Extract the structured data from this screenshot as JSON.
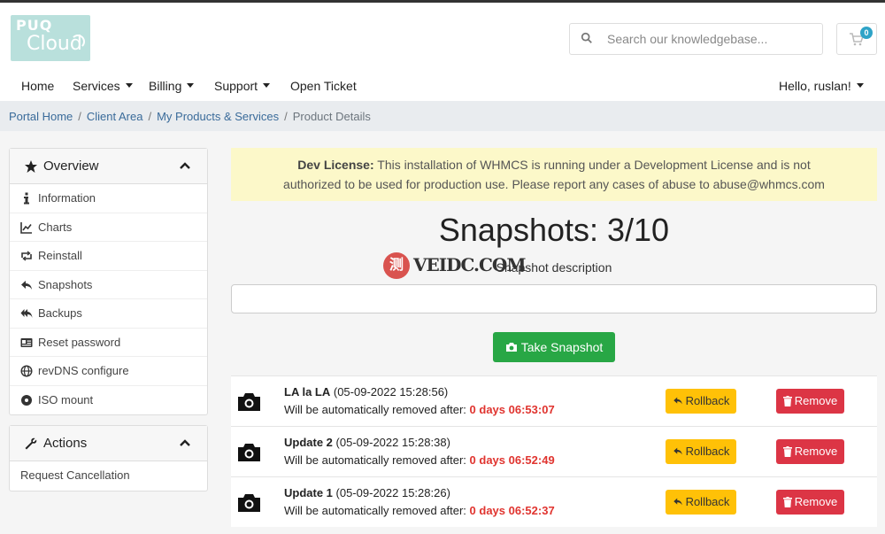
{
  "brand": {
    "logo_line1": "PUQ",
    "logo_line2": "Cloud"
  },
  "search": {
    "placeholder": "Search our knowledgebase..."
  },
  "cart": {
    "count": "0"
  },
  "nav": {
    "home": "Home",
    "services": "Services",
    "billing": "Billing",
    "support": "Support",
    "open_ticket": "Open Ticket",
    "user": "Hello, ruslan!"
  },
  "breadcrumb": {
    "portal_home": "Portal Home",
    "client_area": "Client Area",
    "products": "My Products & Services",
    "current": "Product Details"
  },
  "overview": {
    "title": "Overview",
    "items": [
      {
        "label": "Information",
        "icon": "info-icon"
      },
      {
        "label": "Charts",
        "icon": "chart-icon"
      },
      {
        "label": "Reinstall",
        "icon": "retweet-icon"
      },
      {
        "label": "Snapshots",
        "icon": "reply-icon"
      },
      {
        "label": "Backups",
        "icon": "reply-all-icon"
      },
      {
        "label": "Reset password",
        "icon": "id-card-icon"
      },
      {
        "label": "revDNS configure",
        "icon": "globe-icon"
      },
      {
        "label": "ISO mount",
        "icon": "disc-icon"
      }
    ]
  },
  "actions": {
    "title": "Actions",
    "items": [
      {
        "label": "Request Cancellation"
      }
    ]
  },
  "alert": {
    "bold": "Dev License:",
    "text_line1": "This installation of WHMCS is running under a Development License and is not",
    "text_line2": "authorized to be used for production use. Please report any cases of abuse to abuse@whmcs.com"
  },
  "snapshots": {
    "title": "Snapshots: 3/10",
    "desc_label": "Snapshot description",
    "desc_value": "",
    "take_label": "Take Snapshot",
    "removal_prefix": "Will be automatically removed after:",
    "rollback_label": "Rollback",
    "remove_label": "Remove",
    "items": [
      {
        "name": "LA la LA",
        "date": "(05-09-2022 15:28:56)",
        "ttl": "0 days 06:53:07"
      },
      {
        "name": "Update 2",
        "date": "(05-09-2022 15:28:38)",
        "ttl": "0 days 06:52:49"
      },
      {
        "name": "Update 1",
        "date": "(05-09-2022 15:28:26)",
        "ttl": "0 days 06:52:37"
      }
    ]
  },
  "watermark": {
    "glyph": "测",
    "text": "VEIDC.COM"
  },
  "colors": {
    "green": "#28a745",
    "yellow": "#ffc107",
    "red": "#dc3545",
    "ttl": "#e0342f",
    "alert_bg": "#fcf8c9",
    "link": "#3a6b9a"
  }
}
